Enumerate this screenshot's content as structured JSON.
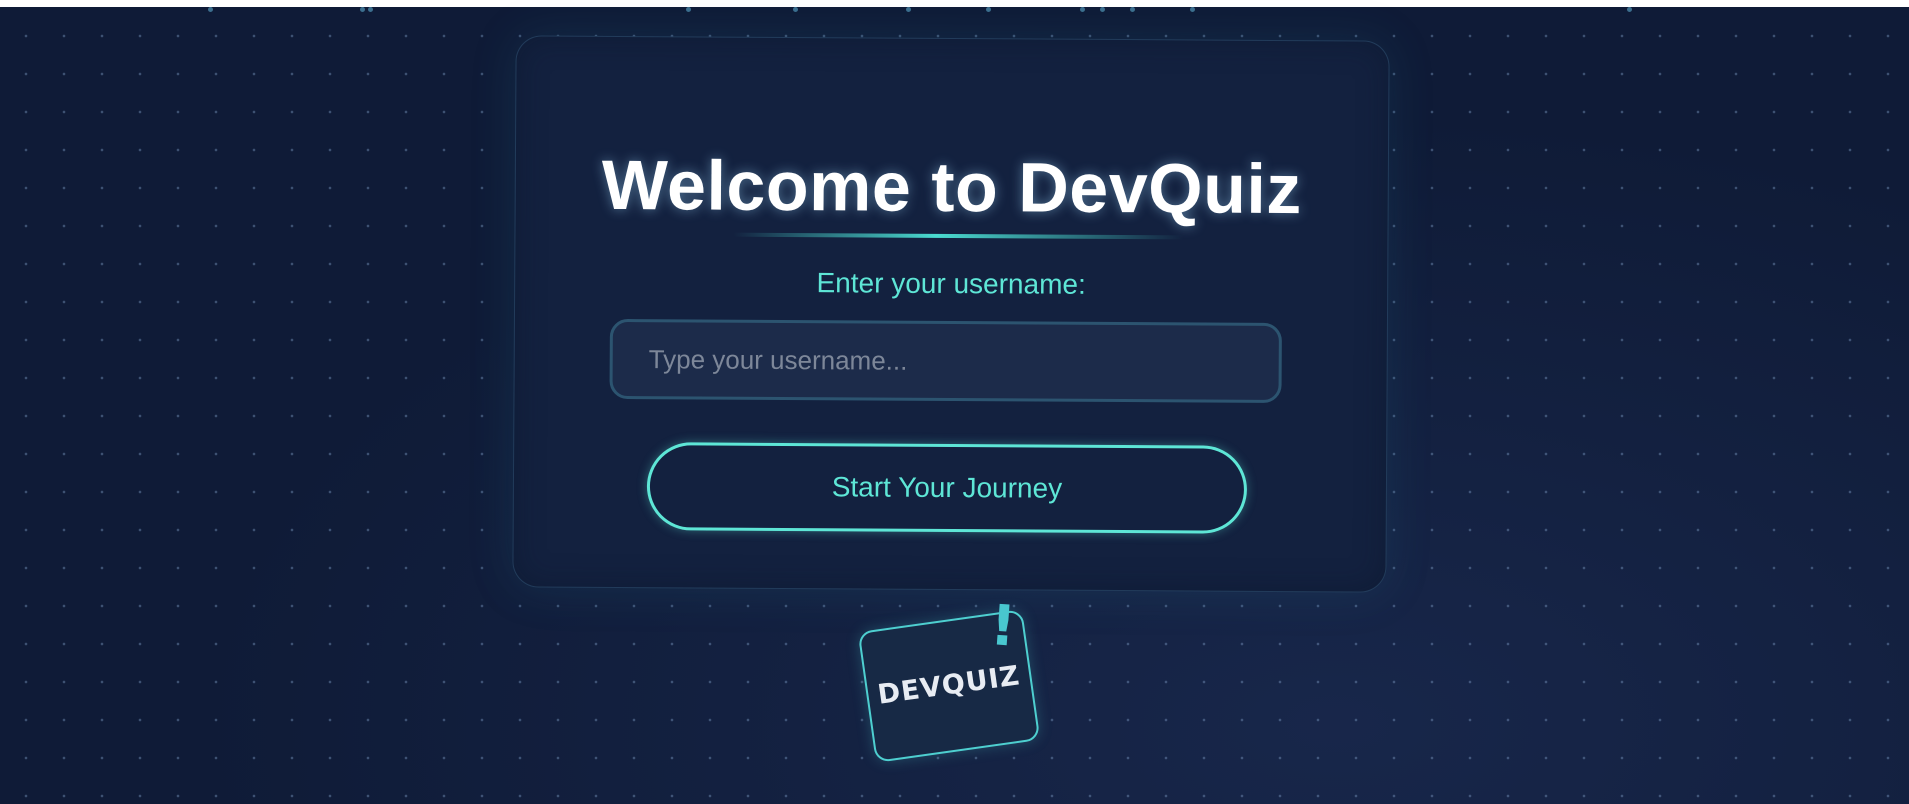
{
  "welcome": {
    "title": "Welcome to DevQuiz",
    "username_label": "Enter your username:",
    "username_value": "",
    "username_placeholder": "Type your username...",
    "start_button_label": "Start Your Journey"
  },
  "logo": {
    "text": "DEVQUIZ",
    "mark": "!"
  },
  "colors": {
    "background": "#0f1b37",
    "card": "#13213f",
    "accent": "#5ee6d6",
    "input_bg": "#1c2b4a",
    "title": "#ffffff"
  },
  "icons": {
    "logo_badge": "exclamation-badge"
  }
}
